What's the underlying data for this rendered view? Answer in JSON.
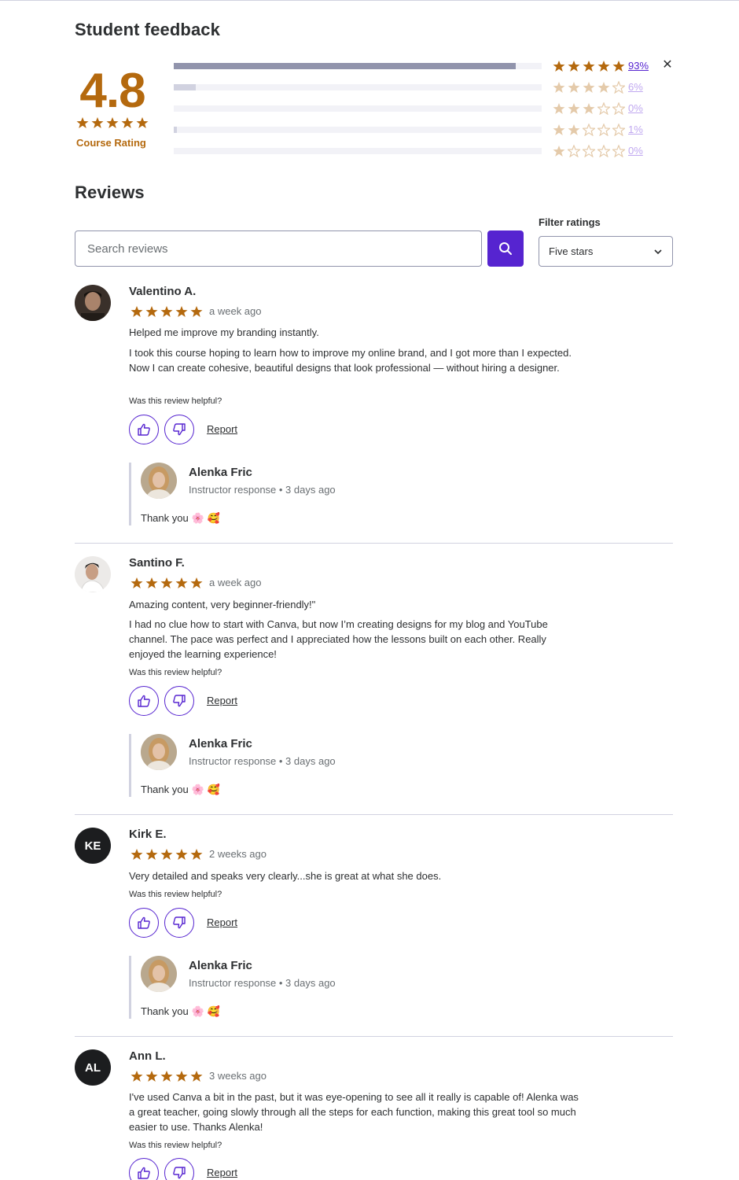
{
  "feedback": {
    "title": "Student feedback",
    "rating": "4.8",
    "rating_label": "Course Rating",
    "star_color": "#b4690e",
    "breakdown": [
      {
        "stars": 5,
        "percent_value": 93,
        "percent": "93%"
      },
      {
        "stars": 4,
        "percent_value": 6,
        "percent": "6%"
      },
      {
        "stars": 3,
        "percent_value": 0,
        "percent": "0%"
      },
      {
        "stars": 2,
        "percent_value": 1,
        "percent": "1%"
      },
      {
        "stars": 1,
        "percent_value": 0,
        "percent": "0%"
      }
    ],
    "clear_icon": "close-icon"
  },
  "reviews_section": {
    "title": "Reviews",
    "search_placeholder": "Search reviews",
    "search_icon": "search-icon",
    "filter_label": "Filter ratings",
    "filter_value": "Five stars",
    "accent": "#5624d0"
  },
  "reviews": [
    {
      "name": "Valentino A.",
      "stars": 5,
      "time": "a week ago",
      "title": "Helped me improve my branding instantly.",
      "body": "I took this course hoping to learn how to improve my online brand, and I got more than I expected. Now I can create cohesive, beautiful designs that look professional — without hiring a designer.",
      "helpful": "Was this review helpful?",
      "report": "Report",
      "response": {
        "name": "Alenka Fric",
        "meta": "Instructor response • 3 days ago",
        "text": "Thank you",
        "emoji": "🌸 🥰"
      }
    },
    {
      "name": "Santino F.",
      "stars": 5,
      "time": "a week ago",
      "title": "Amazing content, very beginner-friendly!\"",
      "body": "I had no clue how to start with Canva, but now I’m creating designs for my blog and YouTube channel. The pace was perfect and I appreciated how the lessons built on each other. Really enjoyed the learning experience!",
      "helpful": "Was this review helpful?",
      "report": "Report",
      "response": {
        "name": "Alenka Fric",
        "meta": "Instructor response • 3 days ago",
        "text": "Thank you",
        "emoji": "🌸 🥰"
      }
    },
    {
      "name": "Kirk E.",
      "initials": "KE",
      "stars": 5,
      "time": "2 weeks ago",
      "body": "Very detailed and speaks very clearly...she is great at what she does.",
      "helpful": "Was this review helpful?",
      "report": "Report",
      "response": {
        "name": "Alenka Fric",
        "meta": "Instructor response • 3 days ago",
        "text": "Thank you",
        "emoji": "🌸 🥰"
      }
    },
    {
      "name": "Ann L.",
      "initials": "AL",
      "stars": 5,
      "time": "3 weeks ago",
      "body": "I've used Canva a bit in the past, but it was eye-opening to see all it really is capable of! Alenka was a great teacher, going slowly through all the steps for each function, making this great tool so much easier to use. Thanks Alenka!",
      "helpful": "Was this review helpful?",
      "report": "Report"
    }
  ]
}
